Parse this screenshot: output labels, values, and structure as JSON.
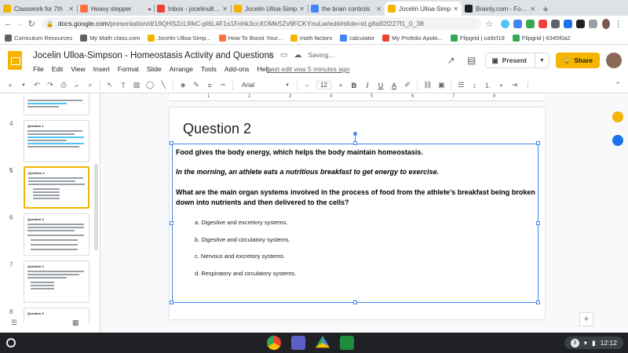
{
  "browser": {
    "tabs": [
      {
        "title": "Classwork for 7th",
        "color": "#f4b400"
      },
      {
        "title": "Heavy stepper",
        "color": "#ff7043"
      },
      {
        "title": "Inbox - jocelinu811",
        "color": "#ea4335"
      },
      {
        "title": "Jocelin Ulloa-Simp",
        "color": "#f4b400"
      },
      {
        "title": "the brain controls",
        "color": "#4285f4"
      },
      {
        "title": "Jocelin Ulloa-Simp",
        "color": "#f4b400",
        "active": true
      },
      {
        "title": "Brainly.com - For s",
        "color": "#202124"
      }
    ],
    "new_tab": "+",
    "url_host": "docs.google.com",
    "url_path": "/presentation/d/19QHSZcLRkC-pI6L4F1s1Fnhk3ccXOMkSZv9FCKYnuLw/edit#slide=id.g8a92f227f1_0_38",
    "bookmarks": [
      {
        "label": "Curriculum Resources",
        "color": "#5f6368"
      },
      {
        "label": "My Math class.com",
        "color": "#5f6368"
      },
      {
        "label": "Jocelin Ulloa-Simp...",
        "color": "#f4b400"
      },
      {
        "label": "How To Boost Your...",
        "color": "#ff7043"
      },
      {
        "label": "math factors",
        "color": "#f4b400"
      },
      {
        "label": "calculator",
        "color": "#4285f4"
      },
      {
        "label": "My Profolio Apolo...",
        "color": "#ea4335"
      },
      {
        "label": "Flipgrid | ca9cf19",
        "color": "#34a853"
      },
      {
        "label": "Flipgrid | 6345f0a2",
        "color": "#34a853"
      }
    ]
  },
  "doc": {
    "title": "Jocelin Ulloa-Simpson - Homeostasis Activity and Questions",
    "saving": "Saving...",
    "menu": [
      "File",
      "Edit",
      "View",
      "Insert",
      "Format",
      "Slide",
      "Arrange",
      "Tools",
      "Add-ons",
      "Help"
    ],
    "last_edit": "Last edit was 5 minutes ago",
    "present": "Present",
    "share": "Share"
  },
  "toolbar": {
    "font": "Arial",
    "size": "12",
    "minus": "−",
    "plus": "+",
    "bold": "B",
    "italic": "I",
    "underline": "U",
    "textcolor": "A"
  },
  "ruler": [
    "1",
    "2",
    "3",
    "4",
    "5",
    "6",
    "7",
    "8"
  ],
  "filmstrip": {
    "numbers": [
      "4",
      "5",
      "6",
      "7",
      "8"
    ],
    "thumb_titles": [
      "Question 1",
      "Question 2",
      "Question 3",
      "Question 4",
      "Question 5"
    ]
  },
  "slide": {
    "title": "Question 2",
    "line1": "Food gives the body energy, which helps the body maintain homeostasis.",
    "line2": "In the morning, an athlete eats a nutritious breakfast to get energy to exercise.",
    "question": "What are the main organ systems involved in the process of food from the athlete’s breakfast being broken down into nutrients and then delivered to the cells?",
    "options": [
      "a. Digestive and excretory systems.",
      "b. Digestive and circulatory systems.",
      "c. Nervous and excretory systems.",
      "d. Respiratory and circulatory systems."
    ]
  },
  "shelf": {
    "badge": "3",
    "time": "12:12",
    "apps": [
      {
        "name": "chrome",
        "color": "#ea4335"
      },
      {
        "name": "teams",
        "color": "#5b5fc7"
      },
      {
        "name": "drive",
        "color": "#34a853"
      },
      {
        "name": "classroom",
        "color": "#1e8e3e"
      }
    ]
  }
}
